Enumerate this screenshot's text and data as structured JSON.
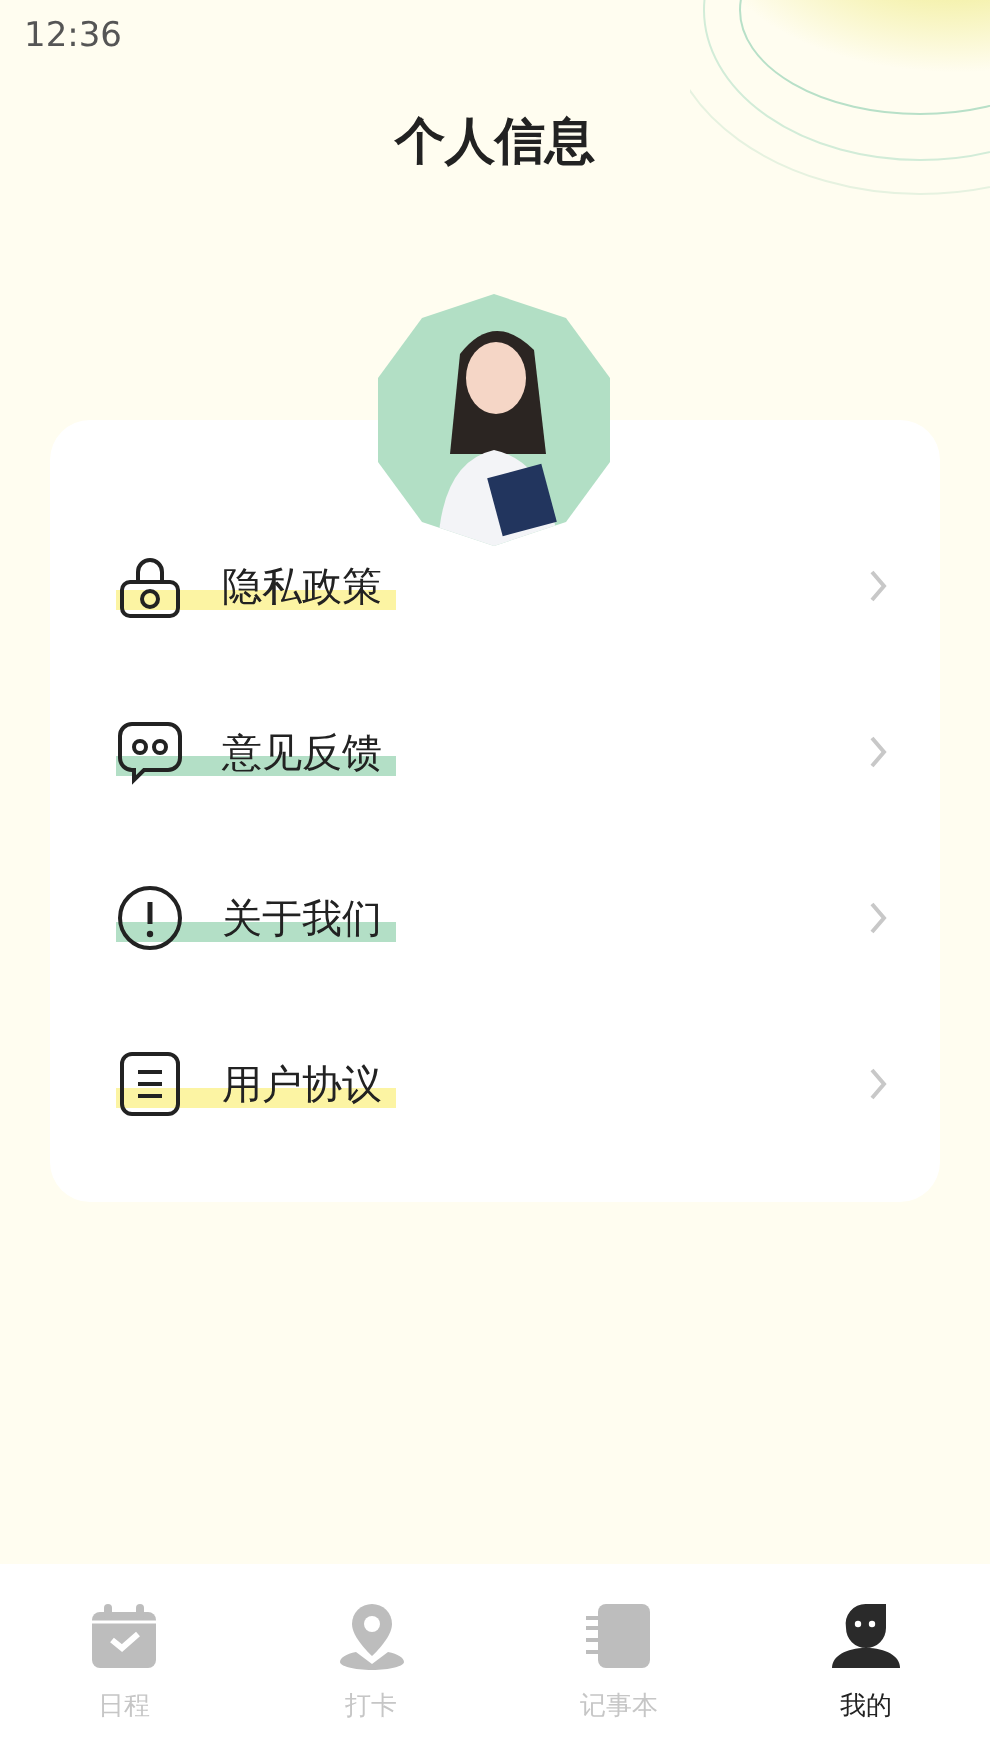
{
  "status_bar": {
    "time": "12:36"
  },
  "title": "个人信息",
  "menu": [
    {
      "kind": "lock",
      "label": "隐私政策",
      "color": "#fcf4a3"
    },
    {
      "kind": "chat",
      "label": "意见反馈",
      "color": "#b3dfc6"
    },
    {
      "kind": "info",
      "label": "关于我们",
      "color": "#b3dfc6"
    },
    {
      "kind": "doc",
      "label": "用户协议",
      "color": "#fcf4a3"
    }
  ],
  "tabs": [
    {
      "kind": "calendar",
      "label": "日程",
      "selected": false
    },
    {
      "kind": "pin",
      "label": "打卡",
      "selected": false
    },
    {
      "kind": "notebook",
      "label": "记事本",
      "selected": false
    },
    {
      "kind": "person",
      "label": "我的",
      "selected": true
    }
  ]
}
